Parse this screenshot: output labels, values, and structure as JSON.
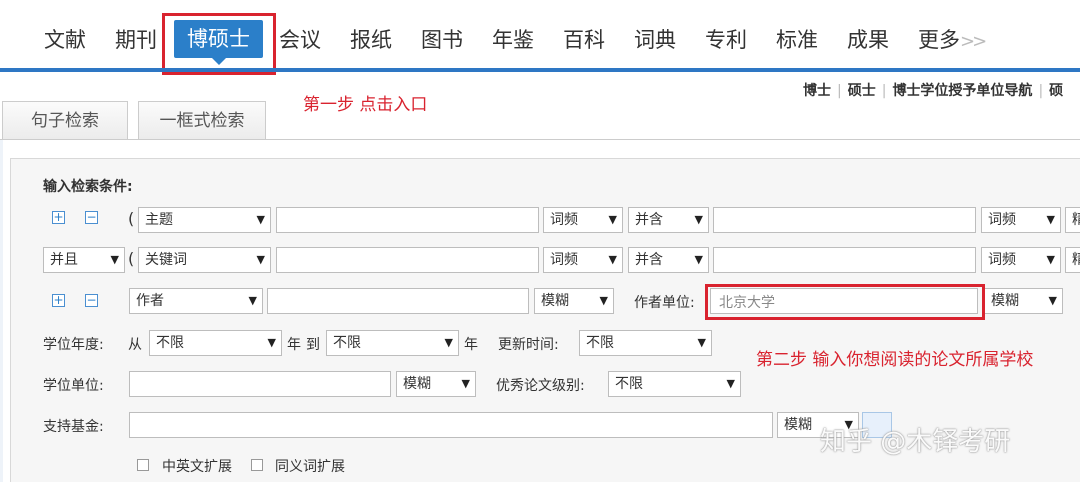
{
  "nav": {
    "items": [
      "文献",
      "期刊",
      "博硕士",
      "会议",
      "报纸",
      "图书",
      "年鉴",
      "百科",
      "词典",
      "专利",
      "标准",
      "成果",
      "更多"
    ],
    "more_arrows": ">>",
    "active": "博硕士"
  },
  "sublinks": [
    "博士",
    "硕士",
    "博士学位授予单位导航",
    "硕"
  ],
  "annotations": {
    "step1": "第一步 点击入口",
    "step2": "第二步 输入你想阅读的论文所属学校"
  },
  "tabs": [
    "句子检索",
    "一框式检索"
  ],
  "form": {
    "title": "输入检索条件:",
    "row1": {
      "paren": "(",
      "field": "主题",
      "match1": "词频",
      "logic": "并含",
      "match2": "词频",
      "trailing": "精"
    },
    "row2": {
      "op": "并且",
      "paren": "(",
      "field": "关键词",
      "match1": "词频",
      "logic": "并含",
      "match2": "词频",
      "trailing": "精"
    },
    "row3": {
      "field": "作者",
      "match": "模糊",
      "unit_label": "作者单位:",
      "unit_value": "北京大学",
      "unit_match": "模糊"
    },
    "year": {
      "label": "学位年度:",
      "from": "从",
      "from_value": "不限",
      "year1": "年",
      "to": "到",
      "to_value": "不限",
      "year2": "年",
      "update_label": "更新时间:",
      "update_value": "不限"
    },
    "unit": {
      "label": "学位单位:",
      "match": "模糊",
      "level_label": "优秀论文级别:",
      "level_value": "不限"
    },
    "fund": {
      "label": "支持基金:",
      "match": "模糊"
    },
    "expand": {
      "cn_en": "中英文扩展",
      "synonym": "同义词扩展"
    }
  },
  "watermark": "知乎 @木铎考研",
  "colors": {
    "accent": "#2b7fc9",
    "annotation_red": "#d9232f"
  }
}
